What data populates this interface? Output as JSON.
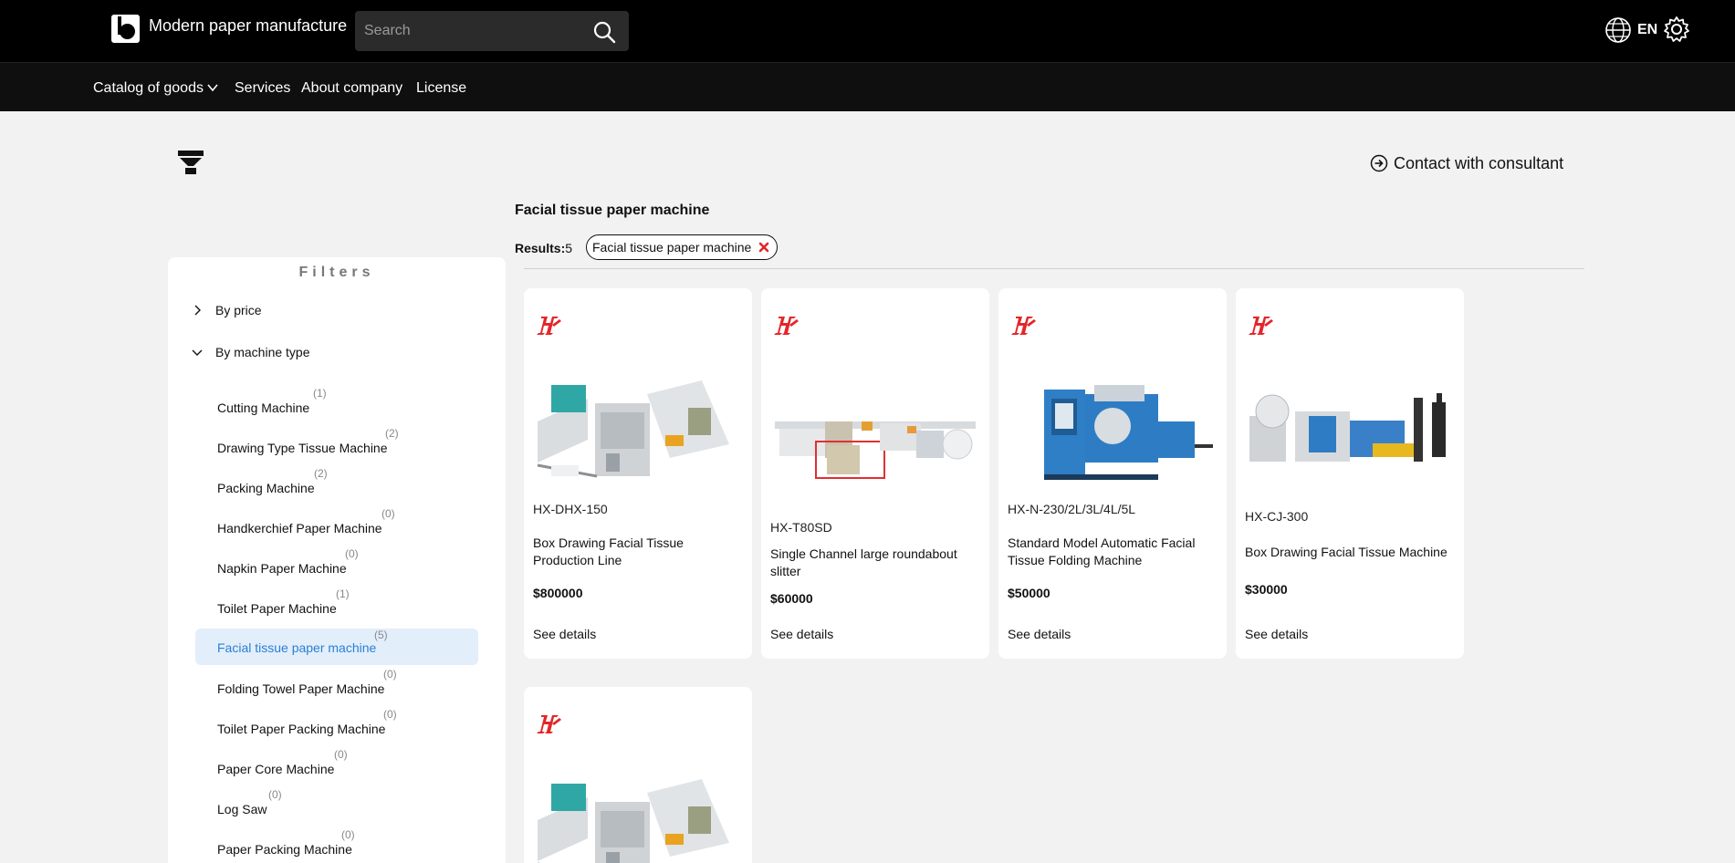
{
  "header": {
    "site_title": "Modern paper manufacture",
    "search_placeholder": "Search",
    "language": "EN"
  },
  "nav": {
    "items": [
      {
        "label": "Catalog of goods"
      },
      {
        "label": "Services"
      },
      {
        "label": "About company"
      },
      {
        "label": "License"
      }
    ]
  },
  "toolbar": {
    "consult_label": "Contact with consultant"
  },
  "sidebar": {
    "title": "Filters",
    "groups": [
      {
        "label": "By price",
        "expanded": false
      },
      {
        "label": "By machine type",
        "expanded": true
      }
    ],
    "types": [
      {
        "label": "Cutting Machine",
        "count": "(1)"
      },
      {
        "label": "Drawing Type Tissue Machine",
        "count": "(2)"
      },
      {
        "label": "Packing Machine",
        "count": "(2)"
      },
      {
        "label": "Handkerchief Paper Machine",
        "count": "(0)"
      },
      {
        "label": "Napkin Paper Machine",
        "count": "(0)"
      },
      {
        "label": "Toilet Paper Machine",
        "count": "(1)"
      },
      {
        "label": "Facial tissue paper machine",
        "count": "(5)",
        "active": true
      },
      {
        "label": "Folding Towel Paper Machine",
        "count": "(0)"
      },
      {
        "label": "Toilet Paper Packing Machine",
        "count": "(0)"
      },
      {
        "label": "Paper Core Machine",
        "count": "(0)"
      },
      {
        "label": "Log Saw",
        "count": "(0)"
      },
      {
        "label": "Paper Packing Machine",
        "count": "(0)"
      }
    ]
  },
  "main": {
    "title": "Facial tissue paper machine",
    "results_label": "Results:",
    "results_count": "5",
    "chip_label": "Facial tissue paper machine",
    "products": [
      {
        "model": "HX-DHX-150",
        "name": "Box Drawing Facial Tissue Production Line",
        "price": "$800000",
        "details": "See details"
      },
      {
        "model": "HX-T80SD",
        "name": "Single Channel large roundabout slitter",
        "price": "$60000",
        "details": "See details"
      },
      {
        "model": "HX-N-230/2L/3L/4L/5L",
        "name": "Standard Model Automatic Facial Tissue Folding Machine",
        "price": "$50000",
        "details": "See details"
      },
      {
        "model": "HX-CJ-300",
        "name": "Box Drawing Facial Tissue Machine",
        "price": "$30000",
        "details": "See details"
      },
      {
        "model": "",
        "name": "",
        "price": "",
        "details": ""
      }
    ]
  },
  "colors": {
    "accent": "#2a7fd4",
    "active_bg": "#e3eefb",
    "brand_red": "#e3262a",
    "topbar": "#000000"
  },
  "icons": [
    "logo-icon",
    "search-icon",
    "globe-icon",
    "gear-icon",
    "chevron-down-icon",
    "filter-icon",
    "arrow-circle-icon",
    "chevron-right-icon",
    "close-icon",
    "brand-logo-icon"
  ]
}
